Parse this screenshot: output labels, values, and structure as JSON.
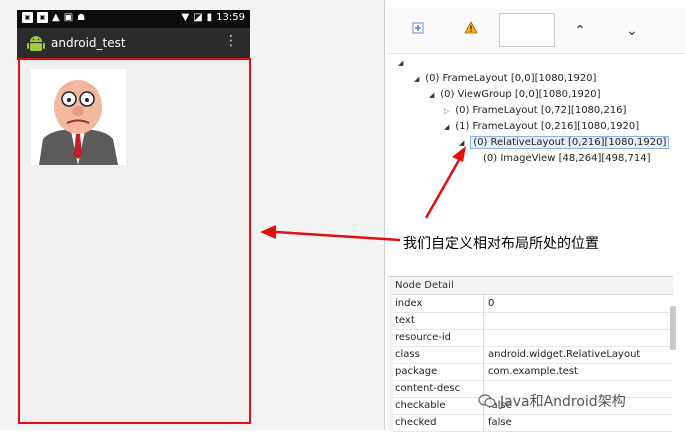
{
  "phone": {
    "status_time": "13:59",
    "app_title": "android_test"
  },
  "toolbar": {
    "expand_icon": "expand-icon",
    "warning_icon": "warning-icon",
    "search_value": "",
    "up_icon": "chevron-up-icon",
    "down_icon": "chevron-down-icon"
  },
  "tree": {
    "nodes": [
      {
        "label": "(0) FrameLayout [0,0][1080,1920]"
      },
      {
        "label": "(0) ViewGroup [0,0][1080,1920]"
      },
      {
        "label": "(0) FrameLayout [0,72][1080,216]"
      },
      {
        "label": "(1) FrameLayout [0,216][1080,1920]"
      },
      {
        "label": "(0) RelativeLayout [0,216][1080,1920]"
      },
      {
        "label": "(0) ImageView [48,264][498,714]"
      }
    ]
  },
  "annotation": "我们自定义相对布局所处的位置",
  "node_detail": {
    "title": "Node Detail",
    "rows": [
      {
        "key": "index",
        "value": "0"
      },
      {
        "key": "text",
        "value": ""
      },
      {
        "key": "resource-id",
        "value": ""
      },
      {
        "key": "class",
        "value": "android.widget.RelativeLayout"
      },
      {
        "key": "package",
        "value": "com.example.test"
      },
      {
        "key": "content-desc",
        "value": ""
      },
      {
        "key": "checkable",
        "value": "false"
      },
      {
        "key": "checked",
        "value": "false"
      }
    ]
  },
  "watermark": "Java和Android架构",
  "colors": {
    "highlight_red": "#e11010",
    "selection": "#e4eefb"
  }
}
